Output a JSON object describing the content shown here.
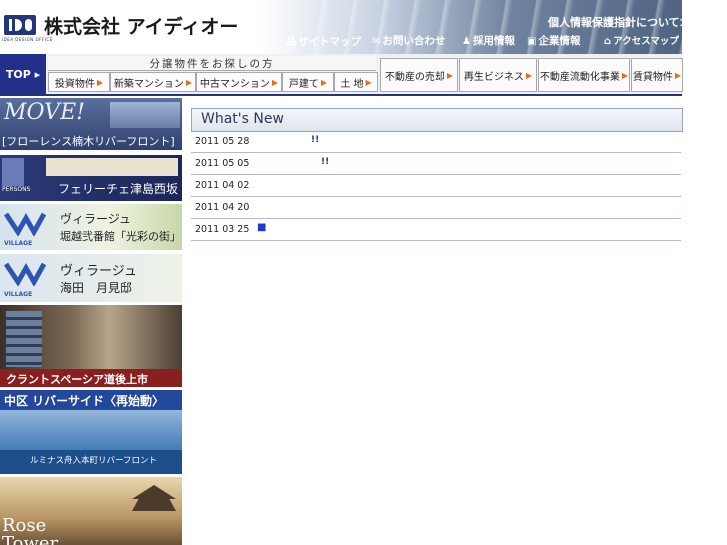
{
  "header": {
    "company_name": "株式会社 アイディオー",
    "logo_sub": "IDEA DESIGN OFFICE",
    "privacy_link": "個人情報保護指針について≫",
    "util_links": [
      {
        "label": "サイトマップ",
        "icon": "sitemap-icon"
      },
      {
        "label": "お問い合わせ",
        "icon": "mail-icon"
      },
      {
        "label": "採用情報",
        "icon": "person-icon"
      },
      {
        "label": "企業情報",
        "icon": "logo-icon"
      },
      {
        "label": "アクセスマップ",
        "icon": "building-icon"
      }
    ]
  },
  "nav": {
    "top_label": "TOP ▸",
    "bunjo_label": "分譲物件をお探しの方",
    "sub_items": [
      "投資物件",
      "新築マンション",
      "中古マンション",
      "戸建て",
      "土 地"
    ],
    "big_items": [
      "不動産の売却",
      "再生ビジネス",
      "不動産流動化事業",
      "賃貸物件"
    ]
  },
  "banners": [
    {
      "title": "MOVE!",
      "subtitle": "[フローレンス楠木リバーフロント]"
    },
    {
      "title": "PERSONS",
      "subtitle": "フェリーチェ津島西坂"
    },
    {
      "title": "ヴィラージュ",
      "subtitle": "堀越弐番館「光彩の街」",
      "tag": "VILLAGE"
    },
    {
      "title": "ヴィラージュ",
      "subtitle": "海田　月見邸",
      "tag": "VILLAGE"
    },
    {
      "title": "クラントスペーシア道後上市"
    },
    {
      "title": "中区 リバーサイド〈再始動〉",
      "subtitle": "ルミナス舟入本町リバーフロント"
    },
    {
      "title": "Rose",
      "subtitle": "Tower"
    }
  ],
  "whats_new": {
    "title": "What's New",
    "items": [
      {
        "date": "2011 05 28",
        "mark": "!!"
      },
      {
        "date": "2011 05 05",
        "mark": "!!"
      },
      {
        "date": "2011 04 02",
        "mark": ""
      },
      {
        "date": "2011 04 20",
        "mark": ""
      },
      {
        "date": "2011 03 25",
        "mark": "■"
      }
    ]
  }
}
